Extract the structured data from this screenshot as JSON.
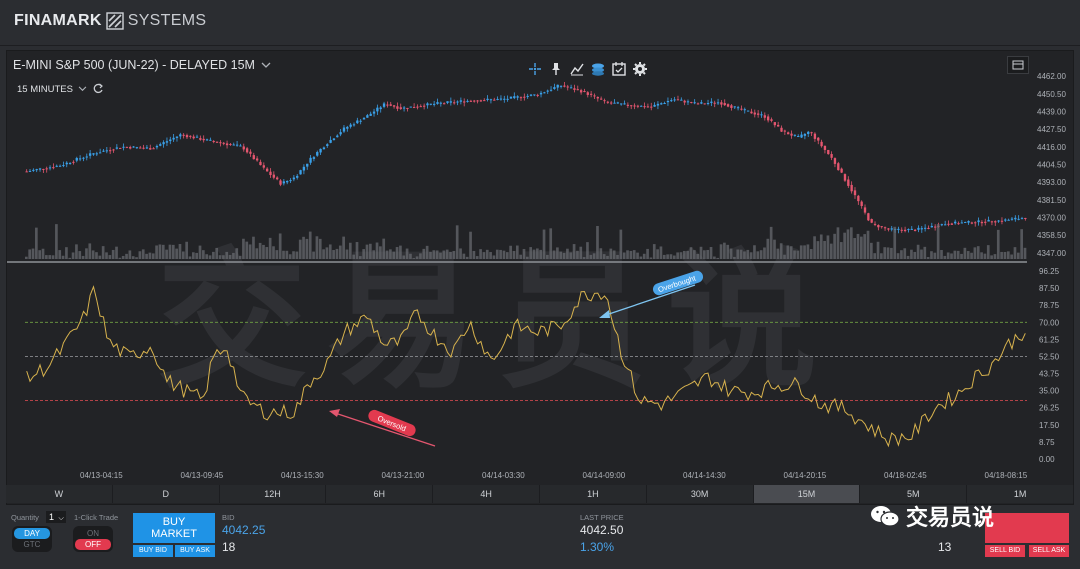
{
  "app": {
    "brand_a": "FINAMARK",
    "brand_b": "SYSTEMS"
  },
  "chart_header": {
    "instrument": "E-MINI S&P 500 (JUN-22) - DELAYED 15M",
    "timeframe": "15 MINUTES",
    "tool_icons": [
      "crosshair-icon",
      "pin-icon",
      "line-chart-icon",
      "layers-icon",
      "calendar-icon",
      "gear-icon"
    ]
  },
  "watermark": "交易员说",
  "colors": {
    "up": "#3aa0e8",
    "down": "#e4566f",
    "rsi": "#d8b34e",
    "overbought_line": "#6fa043",
    "mid_line": "#8a8c90",
    "oversold_line": "#c8474d"
  },
  "annotations": {
    "overbought": "Overbought",
    "oversold": "Oversold"
  },
  "timeframe_bar": [
    "W",
    "D",
    "12H",
    "6H",
    "4H",
    "1H",
    "30M",
    "15M",
    "5M",
    "1M"
  ],
  "active_timeframe": "15M",
  "order": {
    "quantity_label": "Quantity",
    "quantity": "1",
    "oneclick_label": "1-Click Trade",
    "day": "DAY",
    "gtc": "GTC",
    "on": "ON",
    "off": "OFF",
    "buy_line1": "BUY",
    "buy_line2": "MARKET",
    "buy_bid": "BUY BID",
    "buy_ask": "BUY ASK",
    "bid_label": "BID",
    "bid_price": "4042.25",
    "bid_size": "18",
    "last_label": "LAST PRICE",
    "last_price": "4042.50",
    "last_change": "1.30%",
    "sell_bid": "SELL BID",
    "sell_ask": "SELL ASK",
    "ask_size": "13"
  },
  "wechat_label": "交易员说",
  "chart_data": [
    {
      "type": "candlestick",
      "x_ticks": [
        "04/13-04:15",
        "04/13-09:45",
        "04/13-15:30",
        "04/13-21:00",
        "04/14-03:30",
        "04/14-09:00",
        "04/14-14:30",
        "04/14-20:15",
        "04/18-02:45",
        "04/18-08:15"
      ],
      "y_ticks": [
        4462.0,
        4450.5,
        4439.0,
        4427.5,
        4416.0,
        4404.5,
        4393.0,
        4381.5,
        4370.0,
        4358.5,
        4347.0
      ],
      "ylim": [
        4343,
        4464
      ],
      "path": [
        [
          0,
          4400
        ],
        [
          15,
          4404
        ],
        [
          30,
          4412
        ],
        [
          42,
          4416
        ],
        [
          55,
          4415
        ],
        [
          68,
          4424
        ],
        [
          80,
          4420
        ],
        [
          95,
          4416
        ],
        [
          105,
          4401
        ],
        [
          112,
          4392
        ],
        [
          118,
          4396
        ],
        [
          125,
          4408
        ],
        [
          132,
          4418
        ],
        [
          140,
          4428
        ],
        [
          150,
          4436
        ],
        [
          158,
          4444
        ],
        [
          165,
          4441
        ],
        [
          180,
          4444
        ],
        [
          195,
          4446
        ],
        [
          210,
          4447
        ],
        [
          225,
          4450
        ],
        [
          235,
          4456
        ],
        [
          245,
          4452
        ],
        [
          255,
          4445
        ],
        [
          265,
          4443
        ],
        [
          275,
          4442
        ],
        [
          285,
          4447
        ],
        [
          295,
          4444
        ],
        [
          305,
          4445
        ],
        [
          315,
          4440
        ],
        [
          325,
          4436
        ],
        [
          333,
          4426
        ],
        [
          340,
          4422
        ],
        [
          345,
          4426
        ],
        [
          355,
          4408
        ],
        [
          365,
          4384
        ],
        [
          372,
          4366
        ],
        [
          380,
          4362
        ],
        [
          392,
          4362
        ],
        [
          405,
          4366
        ],
        [
          418,
          4367
        ],
        [
          430,
          4368
        ],
        [
          440,
          4370
        ]
      ]
    },
    {
      "type": "line",
      "name": "RSI",
      "y_ticks": [
        96.25,
        87.5,
        78.75,
        70.0,
        61.25,
        52.5,
        43.75,
        35.0,
        26.25,
        17.5,
        8.75,
        0.0
      ],
      "ylim": [
        0,
        96.25
      ],
      "reference_lines": [
        70,
        52.5,
        30
      ],
      "path": [
        [
          0,
          41
        ],
        [
          10,
          48
        ],
        [
          18,
          60
        ],
        [
          25,
          72
        ],
        [
          30,
          87
        ],
        [
          36,
          60
        ],
        [
          45,
          52
        ],
        [
          55,
          58
        ],
        [
          62,
          40
        ],
        [
          70,
          35
        ],
        [
          78,
          30
        ],
        [
          82,
          52
        ],
        [
          88,
          58
        ],
        [
          95,
          31
        ],
        [
          105,
          24
        ],
        [
          118,
          24
        ],
        [
          125,
          40
        ],
        [
          132,
          48
        ],
        [
          140,
          65
        ],
        [
          150,
          73
        ],
        [
          158,
          58
        ],
        [
          165,
          60
        ],
        [
          172,
          75
        ],
        [
          180,
          63
        ],
        [
          188,
          55
        ],
        [
          195,
          70
        ],
        [
          205,
          50
        ],
        [
          215,
          68
        ],
        [
          225,
          65
        ],
        [
          235,
          68
        ],
        [
          245,
          84
        ],
        [
          255,
          86
        ],
        [
          262,
          55
        ],
        [
          270,
          30
        ],
        [
          280,
          28
        ],
        [
          292,
          36
        ],
        [
          300,
          42
        ],
        [
          310,
          35
        ],
        [
          320,
          34
        ],
        [
          330,
          38
        ],
        [
          340,
          38
        ],
        [
          350,
          28
        ],
        [
          360,
          26
        ],
        [
          372,
          16
        ],
        [
          380,
          10
        ],
        [
          390,
          12
        ],
        [
          400,
          26
        ],
        [
          410,
          33
        ],
        [
          418,
          42
        ],
        [
          425,
          48
        ],
        [
          432,
          58
        ],
        [
          440,
          66
        ]
      ]
    }
  ]
}
